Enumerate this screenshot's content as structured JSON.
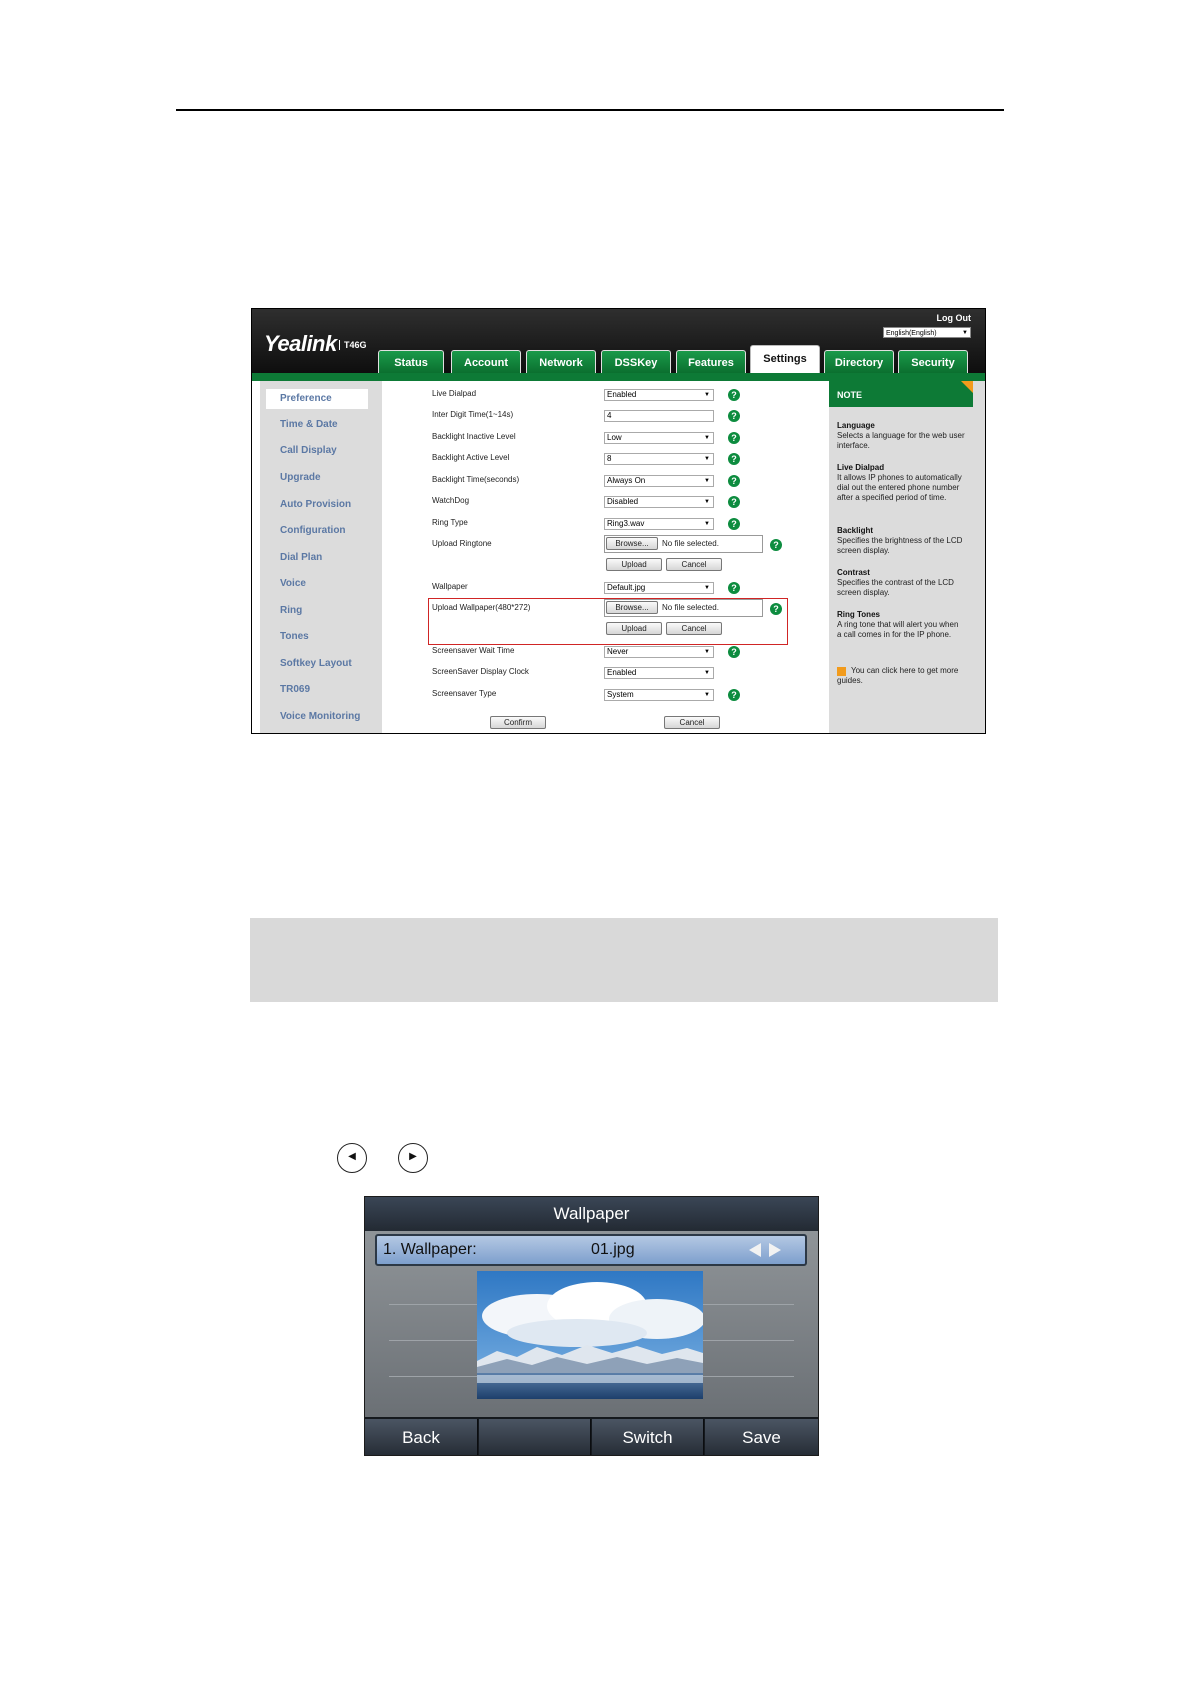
{
  "web": {
    "logo": "Yealink",
    "model": "T46G",
    "logout": "Log Out",
    "language": "English(English)",
    "tabs": [
      "Status",
      "Account",
      "Network",
      "DSSKey",
      "Features",
      "Settings",
      "Directory",
      "Security"
    ],
    "active_tab": "Settings",
    "sidebar": [
      "Preference",
      "Time & Date",
      "Call Display",
      "Upgrade",
      "Auto Provision",
      "Configuration",
      "Dial Plan",
      "Voice",
      "Ring",
      "Tones",
      "Softkey Layout",
      "TR069",
      "Voice Monitoring"
    ],
    "fields": [
      {
        "label": "Live Dialpad",
        "value": "Enabled"
      },
      {
        "label": "Inter Digit Time(1~14s)",
        "value": "4"
      },
      {
        "label": "Backlight Inactive Level",
        "value": "Low"
      },
      {
        "label": "Backlight Active Level",
        "value": "8"
      },
      {
        "label": "Backlight Time(seconds)",
        "value": "Always On"
      },
      {
        "label": "WatchDog",
        "value": "Disabled"
      },
      {
        "label": "Ring Type",
        "value": "Ring3.wav"
      },
      {
        "label": "Upload Ringtone",
        "value": ""
      },
      {
        "label": "Wallpaper",
        "value": "Default.jpg"
      },
      {
        "label": "Upload Wallpaper(480*272)",
        "value": ""
      },
      {
        "label": "Screensaver Wait Time",
        "value": "Never"
      },
      {
        "label": "ScreenSaver Display Clock",
        "value": "Enabled"
      },
      {
        "label": "Screensaver Type",
        "value": "System"
      }
    ],
    "browse": "Browse...",
    "no_file": "No file selected.",
    "upload": "Upload",
    "cancel": "Cancel",
    "confirm": "Confirm",
    "note": {
      "header": "NOTE",
      "sections": [
        {
          "title": "Language",
          "text": "Selects a language for the web user interface."
        },
        {
          "title": "Live Dialpad",
          "text": "It allows IP phones to automatically dial out the entered phone number after a specified period of time."
        },
        {
          "title": "Backlight",
          "text": "Specifies the brightness of the LCD screen display."
        },
        {
          "title": "Contrast",
          "text": "Specifies the contrast of the LCD screen display."
        },
        {
          "title": "Ring Tones",
          "text": "A ring tone that will alert you when a call comes in for the IP phone."
        }
      ],
      "guide": "You can click here to get more guides."
    }
  },
  "phone": {
    "title": "Wallpaper",
    "item_label": "1. Wallpaper:",
    "item_value": "01.jpg",
    "softkeys": [
      "Back",
      "",
      "Switch",
      "Save"
    ]
  },
  "nav_icons": [
    "left-arrow-key",
    "right-arrow-key"
  ]
}
